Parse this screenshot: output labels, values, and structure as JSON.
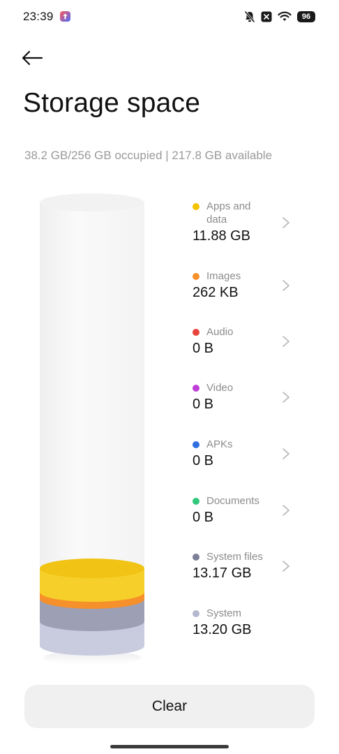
{
  "status_bar": {
    "time": "23:39",
    "battery": "96",
    "icons": [
      "app-notification-icon",
      "mute-bell-icon",
      "sim-off-icon",
      "wifi-icon"
    ]
  },
  "header": {
    "back_icon": "arrow-left-icon",
    "title": "Storage space"
  },
  "summary": "38.2 GB/256 GB occupied | 217.8 GB available",
  "categories": [
    {
      "label": "Apps and data",
      "size": "11.88 GB",
      "color": "#f5c400",
      "has_chevron": true
    },
    {
      "label": "Images",
      "size": "262 KB",
      "color": "#f6902b",
      "has_chevron": true
    },
    {
      "label": "Audio",
      "size": "0 B",
      "color": "#e9443c",
      "has_chevron": true
    },
    {
      "label": "Video",
      "size": "0 B",
      "color": "#bf3fd6",
      "has_chevron": true
    },
    {
      "label": "APKs",
      "size": "0 B",
      "color": "#2f6fe0",
      "has_chevron": true
    },
    {
      "label": "Documents",
      "size": "0 B",
      "color": "#2fc97c",
      "has_chevron": true
    },
    {
      "label": "System files",
      "size": "13.17 GB",
      "color": "#7d7f99",
      "has_chevron": true
    },
    {
      "label": "System",
      "size": "13.20 GB",
      "color": "#b5b9cf",
      "has_chevron": false
    }
  ],
  "colors": {
    "apps": "#f5c400",
    "images": "#f6902b",
    "system_files": "#9fa1b6",
    "system": "#c9ccdb",
    "cylinder_empty": "#f6f6f6"
  },
  "clear_button": "Clear"
}
